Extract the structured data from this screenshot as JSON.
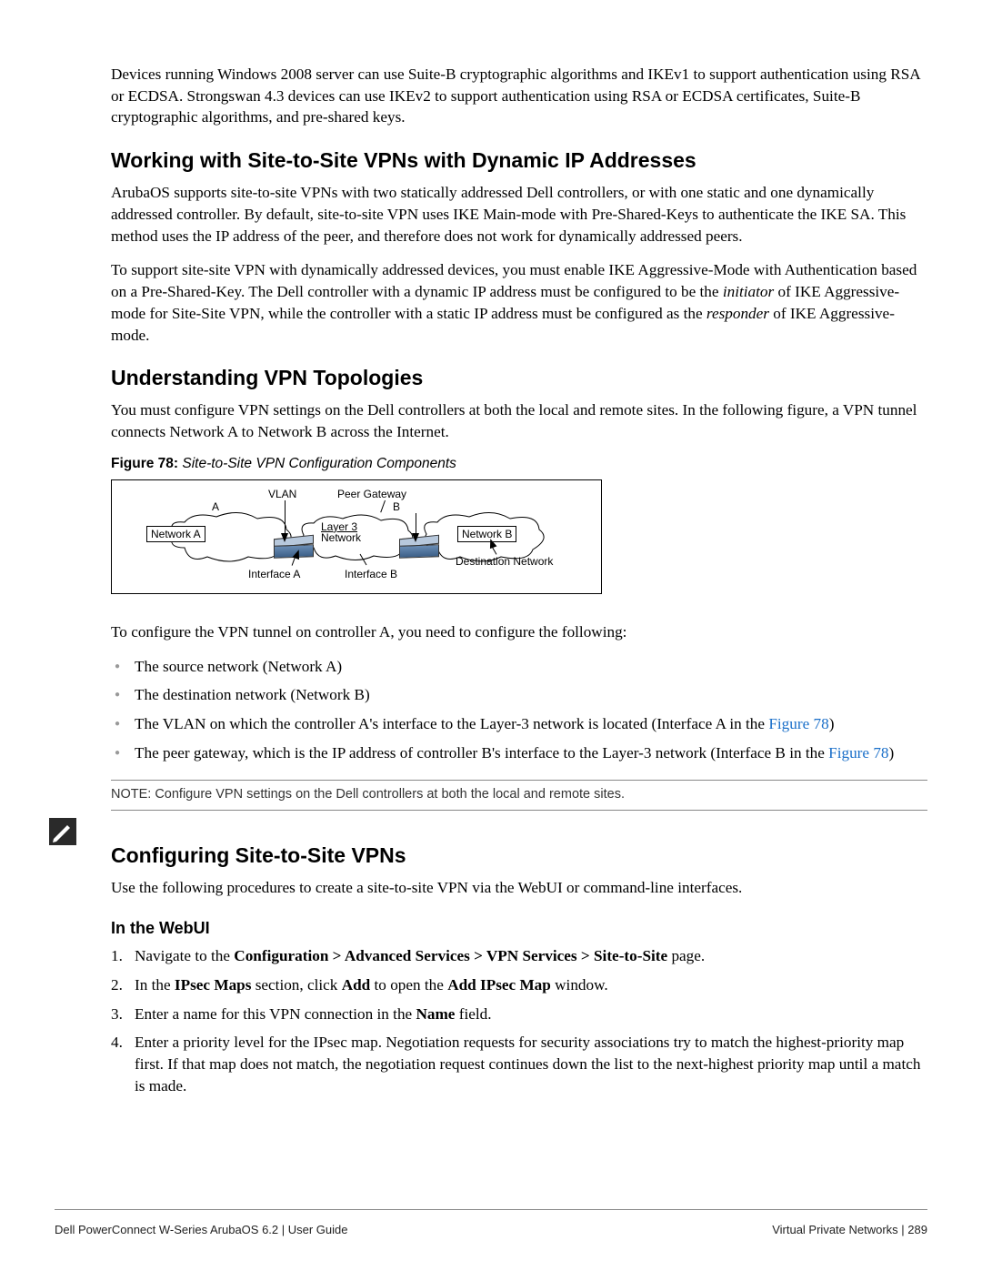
{
  "intro_para": "Devices running Windows 2008 server can use Suite-B cryptographic algorithms and IKEv1 to support authentication using RSA or ECDSA. Strongswan 4.3 devices can use IKEv2 to support authentication using RSA or ECDSA certificates, Suite-B cryptographic algorithms, and pre-shared keys.",
  "h_dynamic": "Working with Site-to-Site VPNs with Dynamic IP Addresses",
  "dyn_p1": "ArubaOS supports site-to-site VPNs with two statically addressed Dell controllers, or with one static and one dynamically addressed controller. By default, site-to-site VPN uses IKE Main-mode with Pre-Shared-Keys to authenticate the IKE SA. This method uses the IP address of the peer, and therefore does not work for dynamically addressed peers.",
  "dyn_p2_a": "To support site-site VPN with dynamically addressed devices, you must enable IKE Aggressive-Mode with Authentication based on a Pre-Shared-Key. The Dell  controller with a dynamic IP address must be configured to be the ",
  "dyn_p2_i1": "initiator",
  "dyn_p2_b": " of IKE Aggressive-mode for Site-Site VPN, while the controller with a static IP address must be configured as the ",
  "dyn_p2_i2": "responder",
  "dyn_p2_c": " of IKE Aggressive-mode.",
  "h_topo": "Understanding VPN Topologies",
  "topo_p1": "You must configure VPN settings on the Dell controllers at both the local and remote sites. In the following figure, a VPN tunnel connects Network A to Network B across the Internet.",
  "fig_label": "Figure 78:",
  "fig_title": " Site-to-Site VPN Configuration Components",
  "diagram": {
    "vlan": "VLAN",
    "peer": "Peer Gateway",
    "a": "A",
    "b": "B",
    "netA": "Network A",
    "netB": "Network B",
    "l3a": "Layer 3",
    "l3b": "Network",
    "dest": "Destination Network",
    "ifA": "Interface A",
    "ifB": "Interface B"
  },
  "topo_p2": "To configure the VPN tunnel on controller A, you need to configure the following:",
  "bullets": {
    "b1": "The source network (Network A)",
    "b2": "The destination network (Network B)",
    "b3a": "The VLAN on which the controller A's interface to the Layer-3 network is located (Interface A in the ",
    "b3link": "Figure 78",
    "b3b": ")",
    "b4a": "The peer gateway, which is the IP address of controller B's interface to the Layer-3 network (Interface B in the ",
    "b4link": "Figure 78",
    "b4b": ")"
  },
  "note": "NOTE: Configure VPN settings on the Dell controllers at both the local and remote sites.",
  "h_cfg": "Configuring Site-to-Site VPNs",
  "cfg_p1": "Use the following procedures to create a site-to-site VPN via the WebUI or command-line interfaces.",
  "h_webui": "In the WebUI",
  "steps": {
    "s1a": "Navigate to the ",
    "s1b": "Configuration > Advanced Services > VPN Services > Site-to-Site",
    "s1c": " page.",
    "s2a": "In the ",
    "s2b": "IPsec Maps",
    "s2c": " section, click ",
    "s2d": "Add",
    "s2e": " to open the ",
    "s2f": "Add IPsec Map",
    "s2g": " window.",
    "s3a": "Enter a name for this VPN connection in the ",
    "s3b": "Name",
    "s3c": " field.",
    "s4": "Enter a priority level for the IPsec map. Negotiation requests for security associations try to match the highest-priority map first. If that map does not match, the negotiation request continues down the list to the next-highest priority map until a match is made."
  },
  "footer": {
    "left": "Dell PowerConnect W-Series ArubaOS 6.2 | User Guide",
    "right_a": "Virtual Private Networks",
    "right_b": "  |  ",
    "right_c": "289"
  }
}
